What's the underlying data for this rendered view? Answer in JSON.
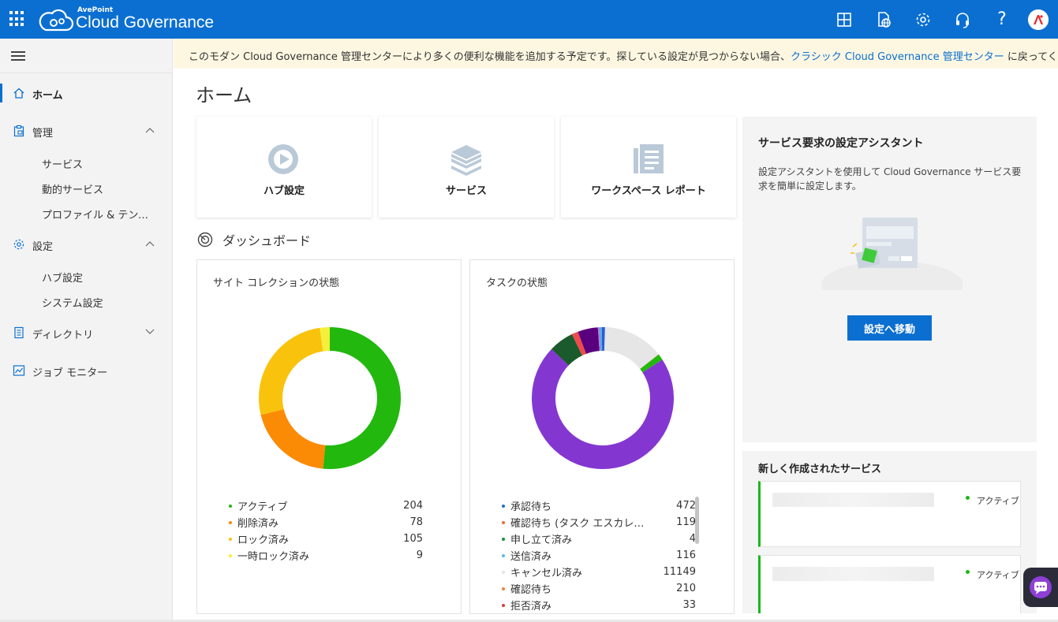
{
  "header": {
    "brand": "AvePoint",
    "product": "Cloud Governance",
    "icons": [
      "apps-grid-icon",
      "grid-icon",
      "globe-document-icon",
      "gear-icon",
      "headset-icon",
      "question-icon",
      "avatar"
    ]
  },
  "sidebar": {
    "items": [
      {
        "label": "ホーム",
        "icon": "home-icon",
        "active": true
      },
      {
        "label": "管理",
        "icon": "clipboard-icon",
        "expanded": true,
        "children": [
          "サービス",
          "動的サービス",
          "プロファイル & テンプレート"
        ]
      },
      {
        "label": "設定",
        "icon": "gear-icon",
        "expanded": true,
        "children": [
          "ハブ設定",
          "システム設定"
        ]
      },
      {
        "label": "ディレクトリ",
        "icon": "list-icon",
        "expanded": false
      },
      {
        "label": "ジョブ モニター",
        "icon": "chart-icon"
      }
    ]
  },
  "banner": {
    "text": "このモダン Cloud Governance 管理センターにより多くの便利な機能を追加する予定です。探している設定が見つからない場合、",
    "link": "クラシック Cloud Governance 管理センター",
    "suffix": " に戻ってください。"
  },
  "page": {
    "title": "ホーム"
  },
  "tiles": [
    {
      "label": "ハブ設定",
      "icon": "hub-icon"
    },
    {
      "label": "サービス",
      "icon": "stack-icon"
    },
    {
      "label": "ワークスペース レポート",
      "icon": "report-icon"
    }
  ],
  "dashboard": {
    "title": "ダッシュボード"
  },
  "chart_data": [
    {
      "type": "pie",
      "title": "サイト コレクションの状態",
      "categories": [
        "アクティブ",
        "削除済み",
        "ロック済み",
        "一時ロック済み"
      ],
      "values": [
        204,
        78,
        105,
        9
      ],
      "colors": [
        "#22b80e",
        "#fb8a05",
        "#f9c20c",
        "#f5ef3a"
      ]
    },
    {
      "type": "pie",
      "title": "タスクの状態",
      "categories": [
        "承認待ち",
        "確認待ち (タスク エスカレート済み)",
        "申し立て済み",
        "送信済み",
        "キャンセル済み",
        "確認待ち",
        "拒否済み"
      ],
      "values": [
        472,
        119,
        4,
        116,
        11149,
        210,
        33
      ],
      "colors": [
        "#1f6fcf",
        "#f06a34",
        "#1b8f35",
        "#62b6ea",
        "#e4e4e4",
        "#e8843a",
        "#e53a3a"
      ]
    }
  ],
  "task_chart_render": {
    "values": [
      1149,
      4,
      116,
      5890,
      472,
      119,
      380,
      33,
      40,
      60
    ],
    "colors": [
      "#e6e6e6",
      "#e8843a",
      "#22b80e",
      "#8437d0",
      "#1b5a2c",
      "#f04b4b",
      "#5a007e",
      "#b07ad8",
      "#4caee8",
      "#2a5fd0"
    ]
  },
  "assistant": {
    "title": "サービス要求の設定アシスタント",
    "description": "設定アシスタントを使用して Cloud Governance サービス要求を簡単に設定します。",
    "button": "設定へ移動"
  },
  "new_services": {
    "title": "新しく作成されたサービス",
    "items": [
      {
        "status": "アクティブ"
      },
      {
        "status": "アクティブ"
      }
    ]
  }
}
